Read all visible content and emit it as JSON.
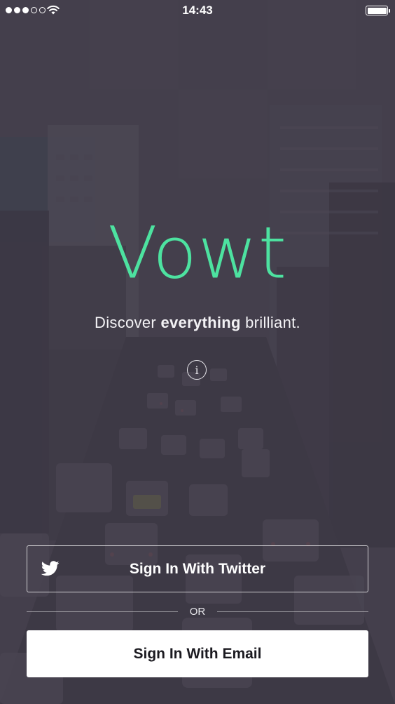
{
  "status_bar": {
    "time": "14:43",
    "signal_filled": 3,
    "signal_total": 5
  },
  "brand": {
    "app_name": "Vowt",
    "tagline_prefix": "Discover",
    "tagline_emphasis": "everything",
    "tagline_suffix": "brilliant."
  },
  "actions": {
    "twitter_label": "Sign In With Twitter",
    "divider_text": "OR",
    "email_label": "Sign In With Email"
  },
  "colors": {
    "accent": "#4de2a0",
    "overlay": "#3f3b48",
    "button_text_dark": "#1b1a20"
  },
  "icons": {
    "info": "info-icon",
    "twitter": "twitter-bird-icon",
    "wifi": "wifi-icon",
    "battery": "battery-icon"
  }
}
